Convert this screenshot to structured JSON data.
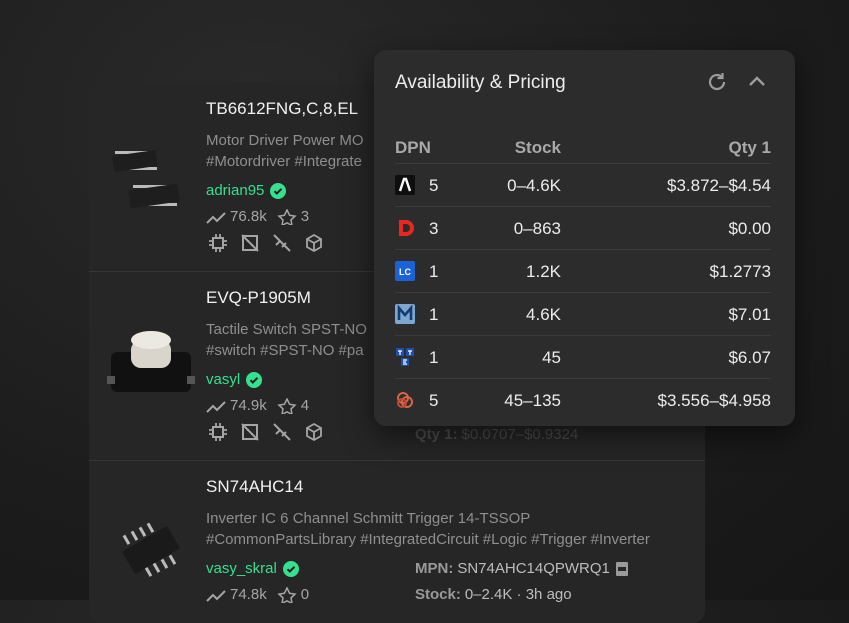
{
  "products": [
    {
      "name": "TB6612FNG,C,8,EL",
      "description_line1": "Motor Driver Power MO",
      "description_line2": "#Motordriver #Integrate",
      "author": "adrian95",
      "views": "76.8k",
      "stars": "3"
    },
    {
      "name": "EVQ-P1905M",
      "description_line1": "Tactile Switch SPST-NO",
      "description_line2": "#switch #SPST-NO #pa",
      "author": "vasyl",
      "views": "74.9k",
      "stars": "4",
      "qty_label": "Qty 1:",
      "qty_value": "$0.0707–$0.9324"
    },
    {
      "name": "SN74AHC14",
      "description_line1": "Inverter IC 6 Channel Schmitt Trigger 14-TSSOP",
      "description_line2": "#CommonPartsLibrary #IntegratedCircuit #Logic #Trigger #Inverter",
      "author": "vasy_skral",
      "views": "74.8k",
      "stars": "0",
      "mpn_label": "MPN:",
      "mpn_value": "SN74AHC14QPWRQ1",
      "stock_label": "Stock:",
      "stock_value": "0–2.4K · 3h ago"
    }
  ],
  "pricing_popup": {
    "title": "Availability & Pricing",
    "columns": {
      "dpn": "DPN",
      "stock": "Stock",
      "qty": "Qty 1"
    },
    "rows": [
      {
        "distributor_icon": "arrow-logo-icon",
        "count": "5",
        "stock": "0–4.6K",
        "price": "$3.872–$4.54"
      },
      {
        "distributor_icon": "digikey-logo-icon",
        "count": "3",
        "stock": "0–863",
        "price": "$0.00"
      },
      {
        "distributor_icon": "lcsc-logo-icon",
        "count": "1",
        "stock": "1.2K",
        "price": "$1.2773"
      },
      {
        "distributor_icon": "mouser-logo-icon",
        "count": "1",
        "stock": "4.6K",
        "price": "$7.01"
      },
      {
        "distributor_icon": "tme-logo-icon",
        "count": "1",
        "stock": "45",
        "price": "$6.07"
      },
      {
        "distributor_icon": "octopart-logo-icon",
        "count": "5",
        "stock": "45–135",
        "price": "$3.556–$4.958"
      }
    ]
  },
  "colors": {
    "accent_green": "#35e08f",
    "background": "#1c1c1c",
    "card": "#262626",
    "popup": "#2c2c2c"
  }
}
